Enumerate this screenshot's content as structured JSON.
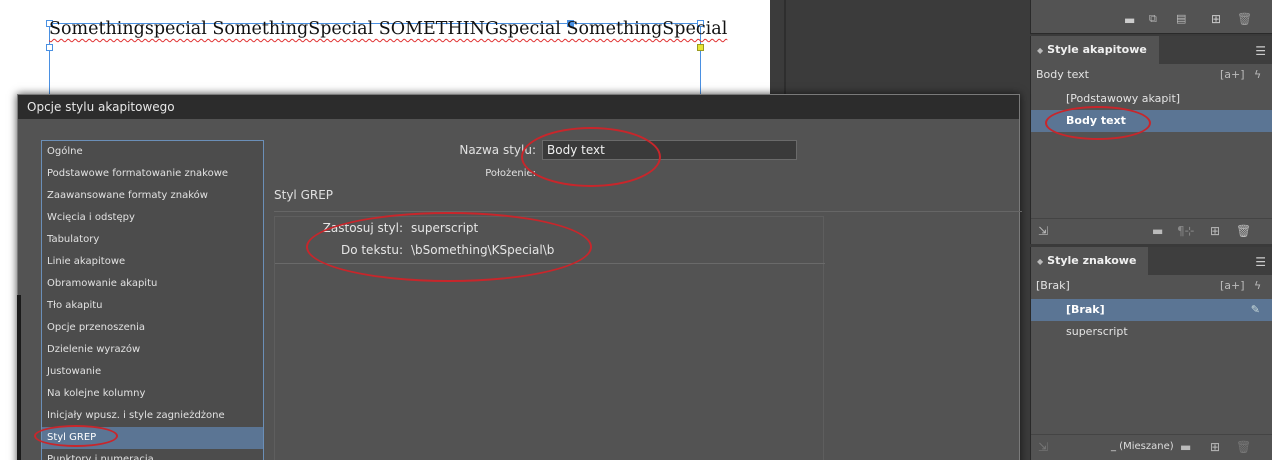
{
  "document": {
    "text": "Somethingspecial SomethingSpecial SOMETHINGspecial SomethingSpecial"
  },
  "panels": {
    "paragraph_styles": {
      "tab_label": "Style akapitowe",
      "current": "Body text",
      "items": [
        {
          "label": "[Podstawowy akapit]",
          "selected": false
        },
        {
          "label": "Body text",
          "selected": true
        }
      ]
    },
    "character_styles": {
      "tab_label": "Style znakowe",
      "current": "[Brak]",
      "items": [
        {
          "label": "[Brak]",
          "selected": true
        },
        {
          "label": "superscript",
          "selected": false
        }
      ],
      "footer_label": "_ (Mieszane)"
    },
    "new_style_badge": "[a+]"
  },
  "dialog": {
    "title": "Opcje stylu akapitowego",
    "categories": [
      "Ogólne",
      "Podstawowe formatowanie znakowe",
      "Zaawansowane formaty znaków",
      "Wcięcia i odstępy",
      "Tabulatory",
      "Linie akapitowe",
      "Obramowanie akapitu",
      "Tło akapitu",
      "Opcje przenoszenia",
      "Dzielenie wyrazów",
      "Justowanie",
      "Na kolejne kolumny",
      "Inicjały wpusz. i style zagnieżdżone",
      "Styl GREP",
      "Punktory i numeracja"
    ],
    "selected_category": "Styl GREP",
    "style_name_label": "Nazwa stylu:",
    "style_name_value": "Body text",
    "location_label": "Położenie:",
    "section_title": "Styl GREP",
    "grep": {
      "apply_style_label": "Zastosuj styl:",
      "apply_style_value": "superscript",
      "to_text_label": "Do tekstu:",
      "to_text_value": "\\bSomething\\KSpecial\\b"
    }
  },
  "colors": {
    "annotation": "#c8262b",
    "selection": "#5b7594",
    "panel_bg": "#535353"
  }
}
